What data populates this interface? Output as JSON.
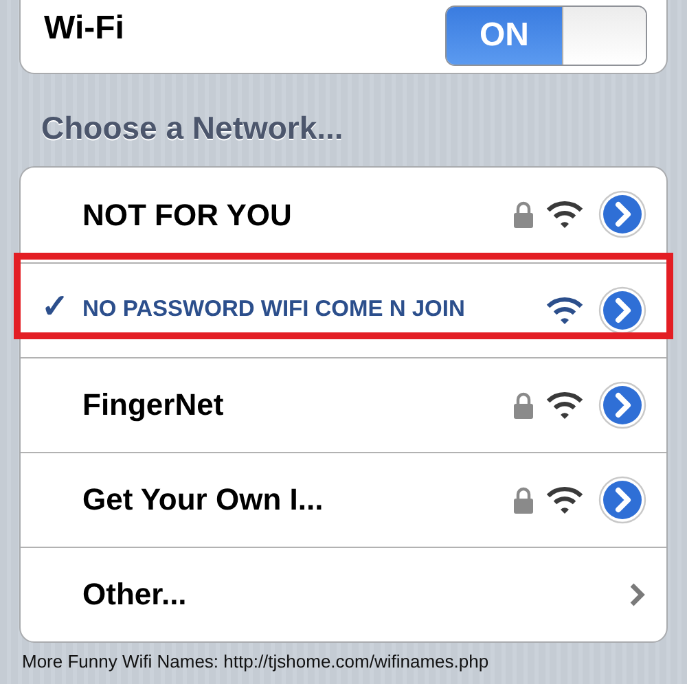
{
  "wifi": {
    "label": "Wi-Fi",
    "on": true,
    "toggle_text": "ON"
  },
  "section_title": "Choose a Network...",
  "check_glyph": "✓",
  "networks": [
    {
      "kind": "network",
      "name": "NOT FOR YOU",
      "selected": false,
      "locked": true,
      "highlighted": false
    },
    {
      "kind": "network",
      "name": "NO PASSWORD WIFI COME N JOIN",
      "selected": true,
      "locked": false,
      "highlighted": true
    },
    {
      "kind": "network",
      "name": "FingerNet",
      "selected": false,
      "locked": true,
      "highlighted": false
    },
    {
      "kind": "network",
      "name": "Get Your Own I...",
      "selected": false,
      "locked": true,
      "highlighted": false
    },
    {
      "kind": "other",
      "name": "Other...",
      "selected": false,
      "highlighted": false
    }
  ],
  "caption": "More Funny Wifi Names: http://tjshome.com/wifinames.php"
}
